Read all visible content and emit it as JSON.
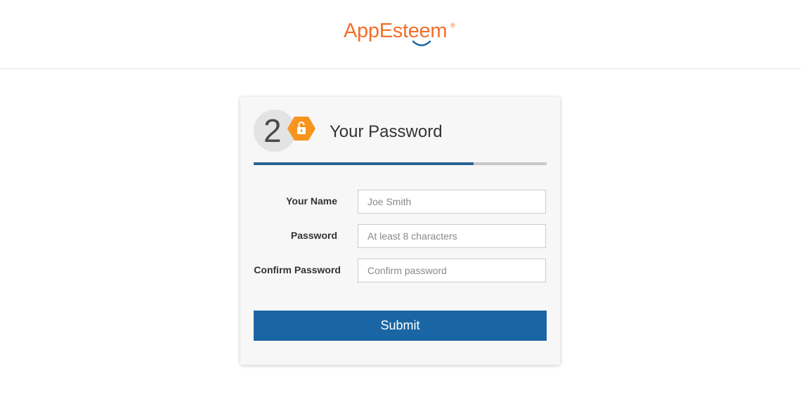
{
  "header": {
    "logo_text": "AppEsteem",
    "logo_registered_mark": "®"
  },
  "card": {
    "step_number": "2",
    "badge_icon": "lock-icon",
    "title": "Your Password",
    "progress": 0.75,
    "fields": [
      {
        "label": "Your Name",
        "value": "",
        "placeholder": "Joe Smith"
      },
      {
        "label": "Password",
        "value": "",
        "placeholder": "At least 8 characters"
      },
      {
        "label": "Confirm Password",
        "value": "",
        "placeholder": "Confirm password"
      }
    ],
    "submit_label": "Submit"
  },
  "colors": {
    "brand_orange": "#f26f2a",
    "badge_orange": "#f7941d",
    "primary_blue": "#1a65a3",
    "progress_blue": "#2a6496",
    "progress_track": "#c8c8c8"
  }
}
